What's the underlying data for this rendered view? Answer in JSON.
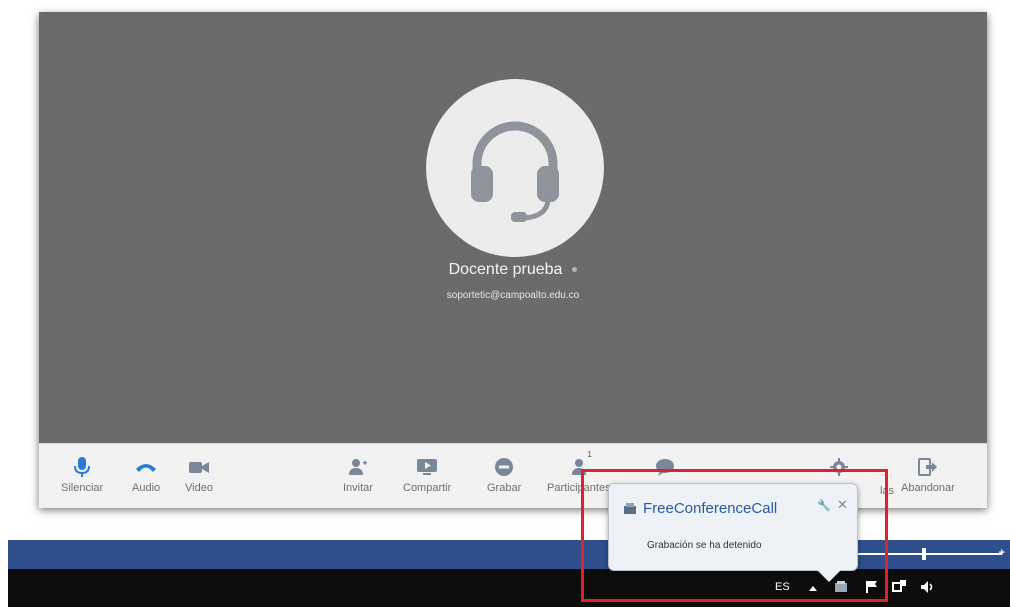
{
  "participant": {
    "name": "Docente prueba",
    "email": "soportetic@campoalto.edu.co",
    "avatar_icon": "headset-icon"
  },
  "toolbar": {
    "mute_label": "Silenciar",
    "audio_label": "Audio",
    "video_label": "Video",
    "invite_label": "Invitar",
    "share_label": "Compartir",
    "record_label": "Grabar",
    "participants_label": "Participantes",
    "participants_count": "1",
    "leave_label": "Abandonar",
    "settings_label_tail": "las"
  },
  "notification": {
    "app_name": "FreeConferenceCall",
    "message": "Grabación se ha detenido"
  },
  "taskbar": {
    "language": "ES"
  },
  "colors": {
    "accent": "#2a7bd3",
    "stage_bg": "#6b6b6b",
    "highlight": "#e0202c",
    "blue_band": "#2e4f8c"
  }
}
